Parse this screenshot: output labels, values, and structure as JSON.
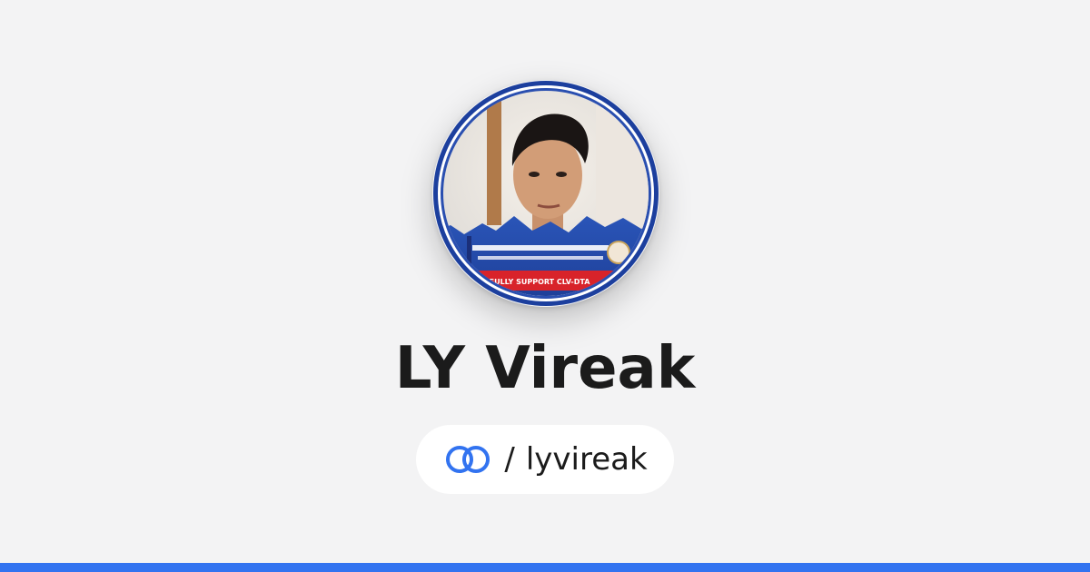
{
  "profile": {
    "name": "LY Vireak",
    "avatar_banner_text": "FULLY SUPPORT CLV-DTA"
  },
  "handle": {
    "separator": "/",
    "username": "lyvireak",
    "icon": "link-rings-icon"
  },
  "colors": {
    "background": "#f3f3f4",
    "accent": "#3273f0",
    "text": "#1b1b1b",
    "avatar_ring": "#1c3f9e",
    "banner_red": "#d8232a"
  }
}
